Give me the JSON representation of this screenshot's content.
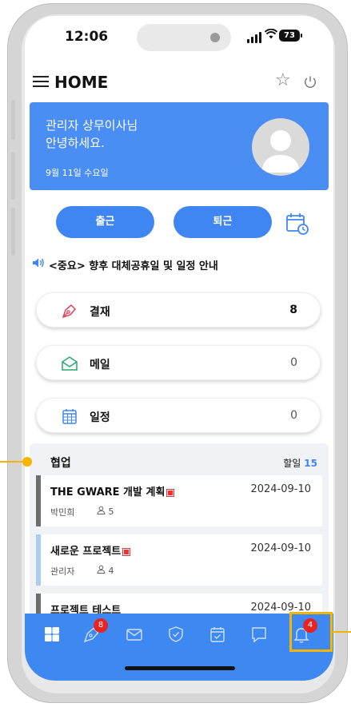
{
  "status_bar": {
    "time": "12:06",
    "battery": "73"
  },
  "header": {
    "title": "HOME"
  },
  "banner": {
    "greeting_line1": "관리자 상무이사님",
    "greeting_line2": "안녕하세요.",
    "date": "9월 11일 수요일"
  },
  "actions": {
    "clock_in": "출근",
    "clock_out": "퇴근"
  },
  "notice": {
    "text": "<중요> 향후 대체공휴일 및 일정 안내"
  },
  "summary_cards": [
    {
      "label": "결재",
      "count": "8"
    },
    {
      "label": "메일",
      "count": "0"
    },
    {
      "label": "일정",
      "count": "0"
    }
  ],
  "collab": {
    "title": "협업",
    "todo_label": "할일",
    "todo_count": "15",
    "projects": [
      {
        "name": "THE GWARE 개발 계획",
        "date": "2024-09-10",
        "owner": "박민희",
        "members": "5",
        "color": "#6e6e6e"
      },
      {
        "name": "새로운 프로젝트",
        "date": "2024-09-10",
        "owner": "관리자",
        "members": "4",
        "color": "#a8cdf2"
      },
      {
        "name": "프로젝트 테스트",
        "date": "2024-09-10",
        "owner": "",
        "members": "",
        "color": "#6e6e6e"
      }
    ]
  },
  "tabbar": {
    "tabs": [
      {
        "icon": "grid-icon"
      },
      {
        "icon": "pen-icon",
        "badge": "8"
      },
      {
        "icon": "mail-icon"
      },
      {
        "icon": "shield-icon"
      },
      {
        "icon": "calendar-check-icon"
      },
      {
        "icon": "chat-icon"
      },
      {
        "icon": "bell-icon",
        "badge": "4"
      }
    ]
  },
  "colors": {
    "primary": "#3e88f1",
    "highlight": "#f5b400",
    "badge": "#e52424"
  }
}
